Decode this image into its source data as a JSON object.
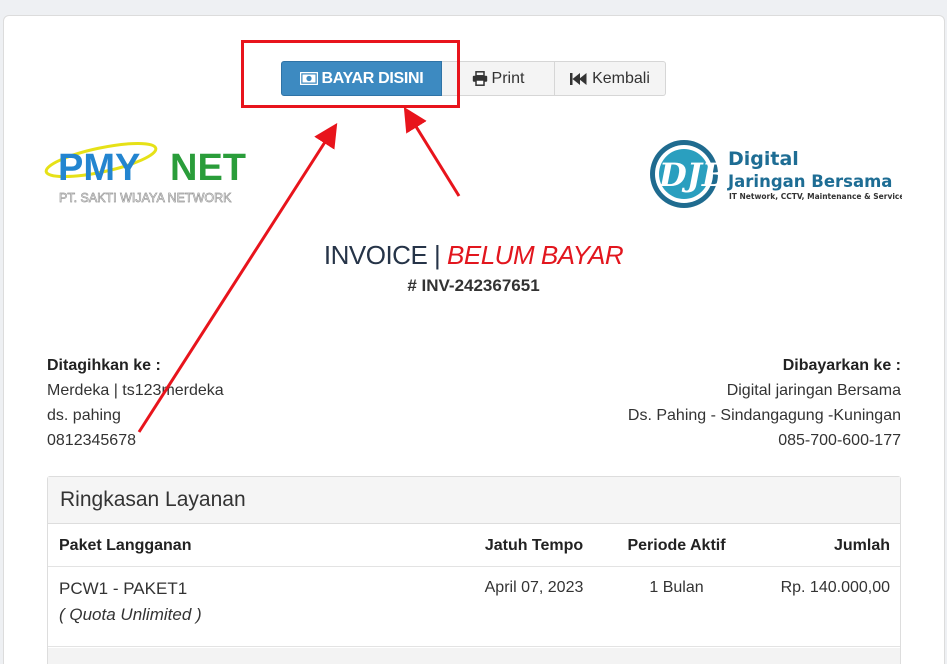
{
  "toolbar": {
    "pay_label": "BAYAR DISINI",
    "print_label": "Print",
    "back_label": "Kembali"
  },
  "logos": {
    "left": {
      "name": "PMY NET",
      "part1": "PMY",
      "part2": "NET",
      "subtitle": "PT. SAKTI WIJAYA NETWORK"
    },
    "right": {
      "mark": "DJB",
      "line1": "Digital",
      "line2": "Jaringan Bersama",
      "tagline": "IT Network, CCTV, Maintenance & Service"
    }
  },
  "invoice": {
    "title": "INVOICE",
    "separator": "|",
    "status": "BELUM BAYAR",
    "number": "# INV-242367651"
  },
  "billed_to": {
    "label": "Ditagihkan ke :",
    "line1": "Merdeka | ts123merdeka",
    "line2": "ds. pahing",
    "line3": "0812345678"
  },
  "paid_to": {
    "label": "Dibayarkan ke :",
    "line1": "Digital jaringan Bersama",
    "line2": "Ds. Pahing - Sindangagung -Kuningan",
    "line3": "085-700-600-177"
  },
  "summary": {
    "title": "Ringkasan Layanan",
    "columns": [
      "Paket Langganan",
      "Jatuh Tempo",
      "Periode Aktif",
      "Jumlah"
    ],
    "rows": [
      {
        "package": "PCW1 - PAKET1",
        "note": "( Quota Unlimited )",
        "due": "April 07, 2023",
        "period": "1 Bulan",
        "amount": "Rp. 140.000,00"
      }
    ]
  },
  "colors": {
    "pay_button": "#3d8ac1",
    "status_red": "#e2161e",
    "annotation_red": "#e8141c"
  }
}
